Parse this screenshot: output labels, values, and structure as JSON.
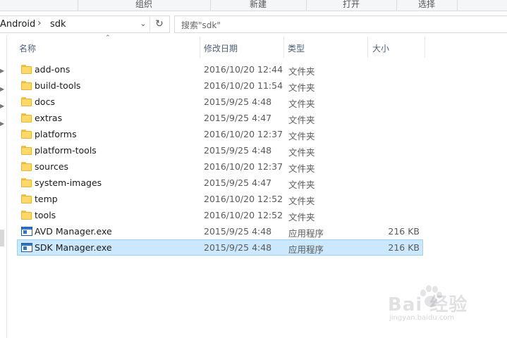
{
  "ribbon": {
    "groups": [
      "组织",
      "新建",
      "打开",
      "选择"
    ]
  },
  "address": {
    "crumbs": [
      "Android",
      "sdk"
    ],
    "separator": "›"
  },
  "search": {
    "placeholder": "搜索\"sdk\""
  },
  "columns": {
    "name": "名称",
    "date": "修改日期",
    "type": "类型",
    "size": "大小"
  },
  "files": [
    {
      "name": "add-ons",
      "date": "2016/10/20 12:44",
      "type": "文件夹",
      "size": "",
      "icon": "folder-icon",
      "selected": false
    },
    {
      "name": "build-tools",
      "date": "2016/10/20 11:54",
      "type": "文件夹",
      "size": "",
      "icon": "folder-icon",
      "selected": false
    },
    {
      "name": "docs",
      "date": "2015/9/25 4:48",
      "type": "文件夹",
      "size": "",
      "icon": "folder-icon",
      "selected": false
    },
    {
      "name": "extras",
      "date": "2015/9/25 4:47",
      "type": "文件夹",
      "size": "",
      "icon": "folder-icon",
      "selected": false
    },
    {
      "name": "platforms",
      "date": "2016/10/20 12:37",
      "type": "文件夹",
      "size": "",
      "icon": "folder-icon",
      "selected": false
    },
    {
      "name": "platform-tools",
      "date": "2015/9/25 4:48",
      "type": "文件夹",
      "size": "",
      "icon": "folder-icon",
      "selected": false
    },
    {
      "name": "sources",
      "date": "2016/10/20 12:37",
      "type": "文件夹",
      "size": "",
      "icon": "folder-icon",
      "selected": false
    },
    {
      "name": "system-images",
      "date": "2015/9/25 4:47",
      "type": "文件夹",
      "size": "",
      "icon": "folder-icon",
      "selected": false
    },
    {
      "name": "temp",
      "date": "2016/10/20 12:52",
      "type": "文件夹",
      "size": "",
      "icon": "folder-icon",
      "selected": false
    },
    {
      "name": "tools",
      "date": "2016/10/20 12:52",
      "type": "文件夹",
      "size": "",
      "icon": "folder-icon",
      "selected": false
    },
    {
      "name": "AVD Manager.exe",
      "date": "2015/9/25 4:48",
      "type": "应用程序",
      "size": "216 KB",
      "icon": "exe-icon",
      "selected": false
    },
    {
      "name": "SDK Manager.exe",
      "date": "2015/9/25 4:48",
      "type": "应用程序",
      "size": "216 KB",
      "icon": "exe-icon",
      "selected": true
    }
  ],
  "watermark": {
    "text": "Bai 经验",
    "url": "jingyan.baidu.com"
  },
  "colors": {
    "selection": "#cce8ff",
    "selection_border": "#99d1ff",
    "folder": "#ffd86a",
    "header_text": "#4c607a"
  }
}
